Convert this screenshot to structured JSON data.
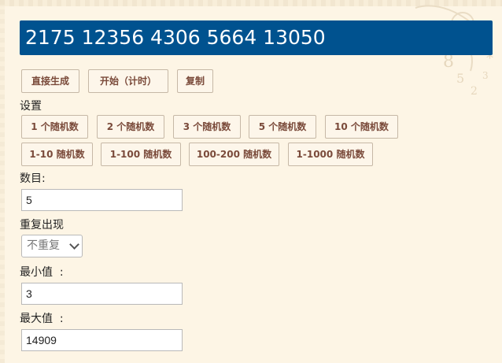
{
  "result": {
    "text": "2175 12356 4306 5664 13050"
  },
  "actions": {
    "generate_label": "直接生成",
    "start_label": "开始（计时）",
    "copy_label": "复制"
  },
  "settings": {
    "heading": "设置",
    "presets_row1": [
      "1 个随机数",
      "2 个随机数",
      "3 个随机数",
      "5 个随机数",
      "10 个随机数"
    ],
    "presets_row2": [
      "1-10 随机数",
      "1-100 随机数",
      "100-200 随机数",
      "1-1000 随机数"
    ]
  },
  "form": {
    "count_label": "数目:",
    "count_value": "5",
    "repeat_label": "重复出现",
    "repeat_selected": "不重复",
    "min_label": "最小值  :",
    "min_value": "3",
    "max_label": "最大值  :",
    "max_value": "14909"
  },
  "colors": {
    "page_bg": "#fdf5e5",
    "result_bg": "#00528f",
    "button_text": "#7a4a3a"
  },
  "icons": {
    "select_arrow": "chevron-down-icon"
  }
}
